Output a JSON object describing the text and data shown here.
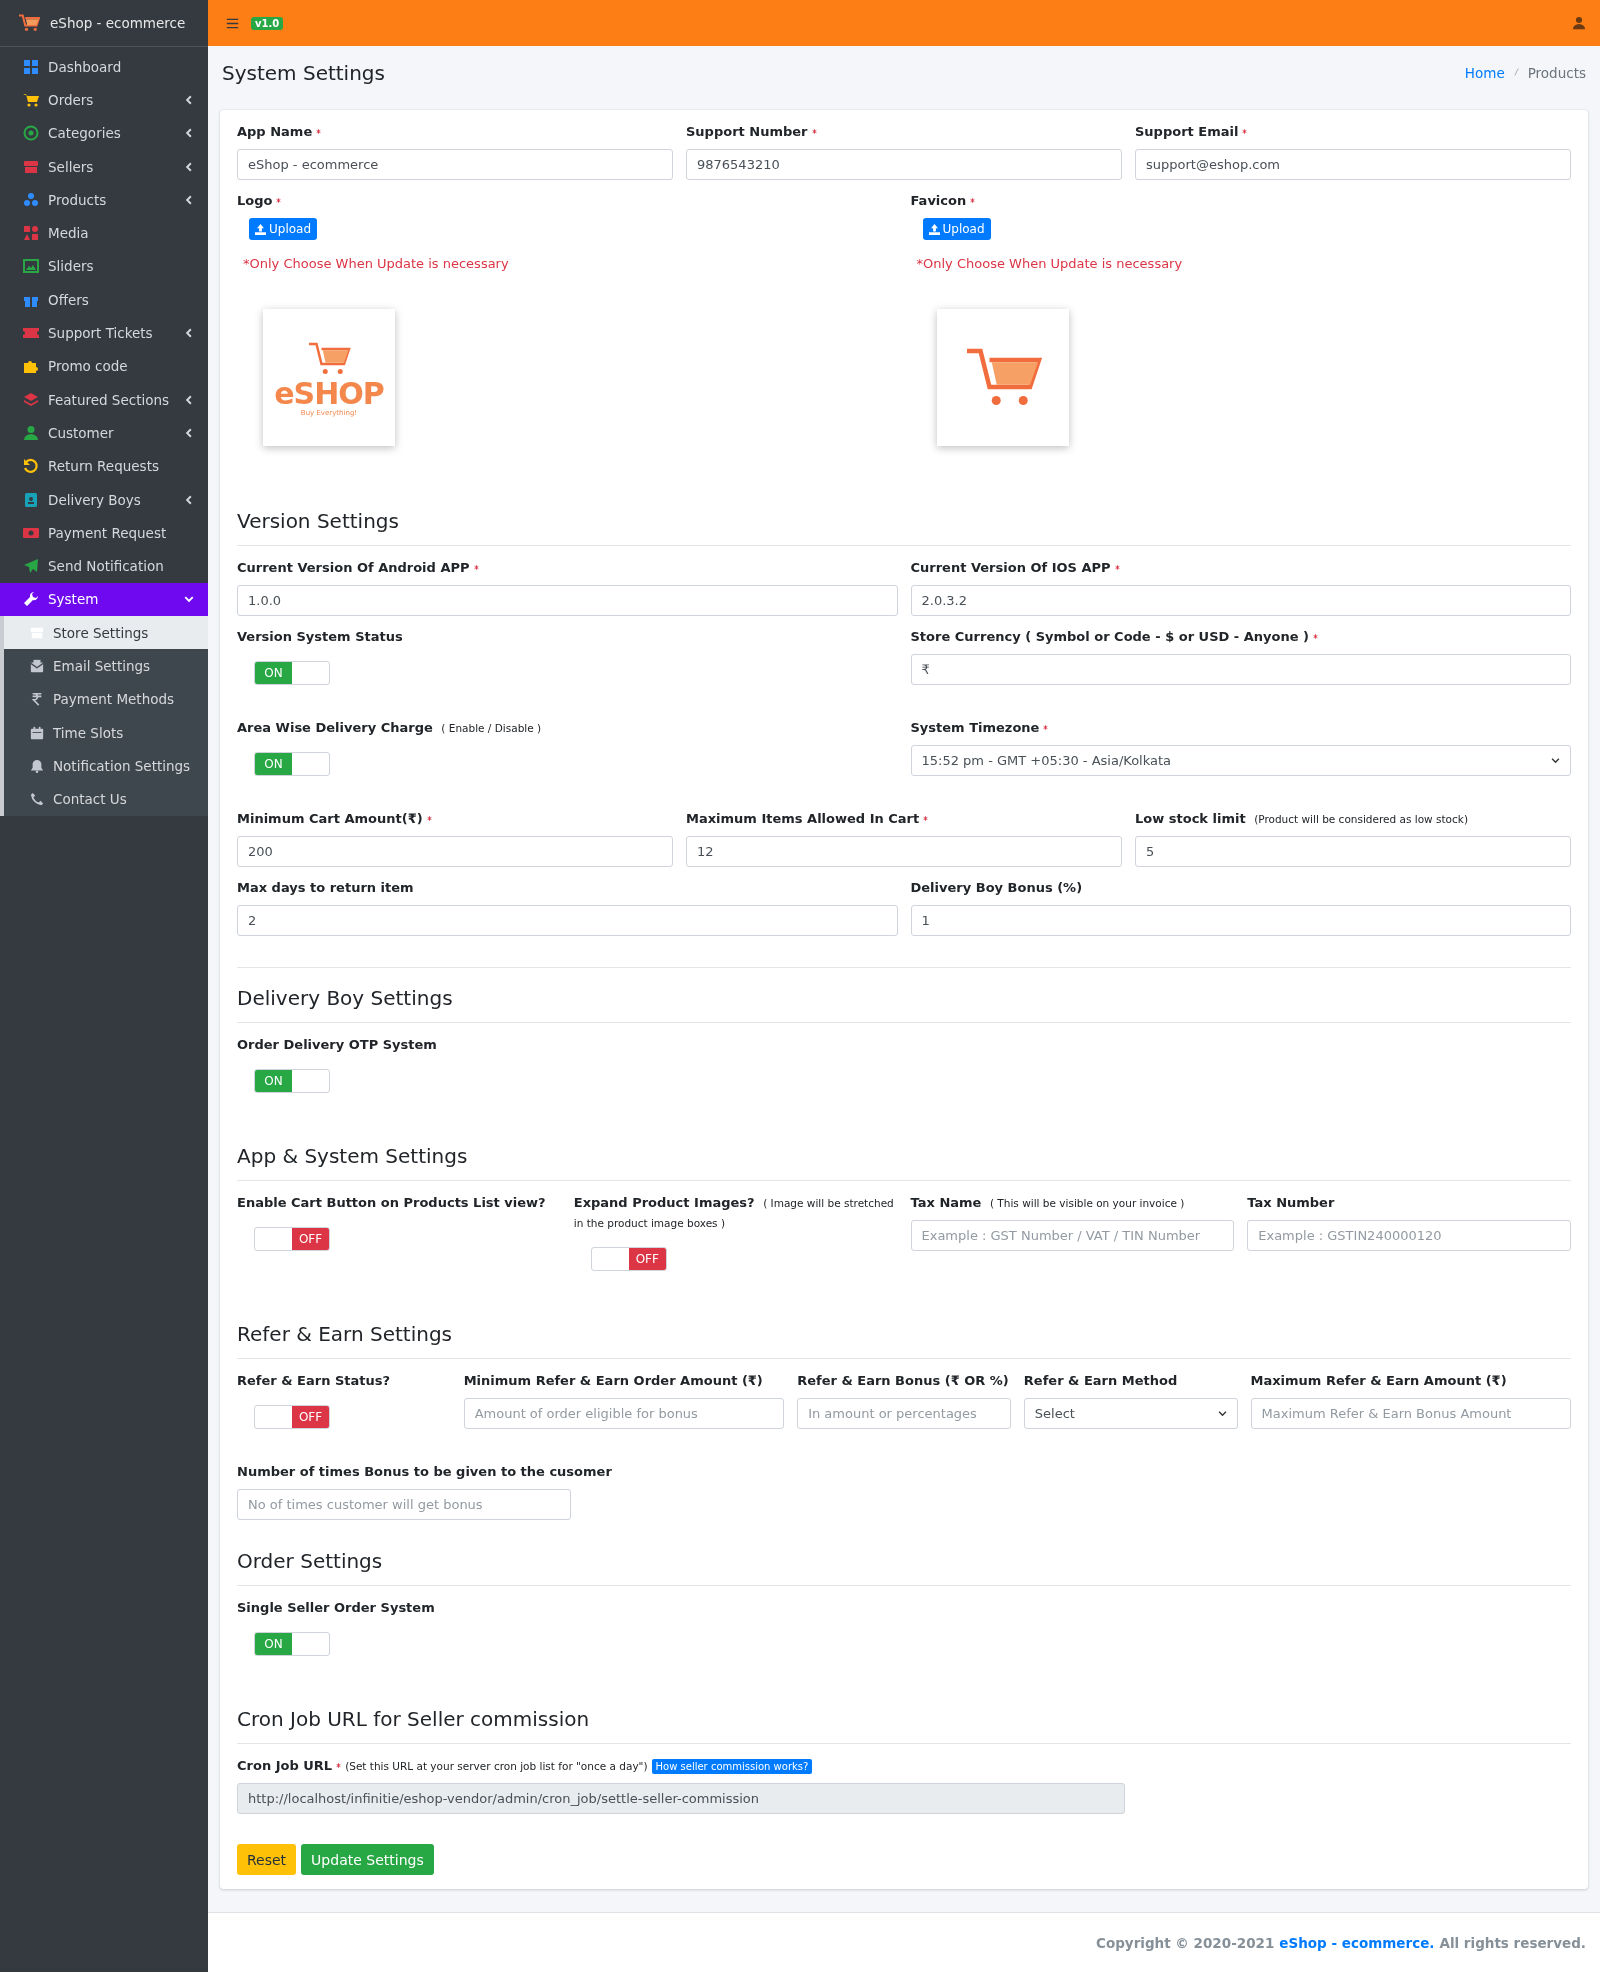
{
  "app": {
    "title": "eShop - ecommerce"
  },
  "sidebar": {
    "items": [
      {
        "label": "Dashboard",
        "expandable": false,
        "selected": false
      },
      {
        "label": "Orders",
        "expandable": true,
        "selected": false
      },
      {
        "label": "Categories",
        "expandable": true,
        "selected": false
      },
      {
        "label": "Sellers",
        "expandable": true,
        "selected": false
      },
      {
        "label": "Products",
        "expandable": true,
        "selected": false
      },
      {
        "label": "Media",
        "expandable": false,
        "selected": false
      },
      {
        "label": "Sliders",
        "expandable": false,
        "selected": false
      },
      {
        "label": "Offers",
        "expandable": false,
        "selected": false
      },
      {
        "label": "Support Tickets",
        "expandable": true,
        "selected": false
      },
      {
        "label": "Promo code",
        "expandable": false,
        "selected": false
      },
      {
        "label": "Featured Sections",
        "expandable": true,
        "selected": false
      },
      {
        "label": "Customer",
        "expandable": true,
        "selected": false
      },
      {
        "label": "Return Requests",
        "expandable": false,
        "selected": false
      },
      {
        "label": "Delivery Boys",
        "expandable": true,
        "selected": false
      },
      {
        "label": "Payment Request",
        "expandable": false,
        "selected": false
      },
      {
        "label": "Send Notification",
        "expandable": false,
        "selected": false
      },
      {
        "label": "System",
        "expandable": true,
        "expanded": true,
        "selected": true,
        "children": [
          {
            "label": "Store Settings",
            "selected": true
          },
          {
            "label": "Email Settings",
            "selected": false
          },
          {
            "label": "Payment Methods",
            "selected": false
          },
          {
            "label": "Time Slots",
            "selected": false
          },
          {
            "label": "Notification Settings",
            "selected": false
          },
          {
            "label": "Contact Us",
            "selected": false
          }
        ]
      }
    ]
  },
  "topbar": {
    "version_badge": "v1.0"
  },
  "page": {
    "title": "System Settings",
    "breadcrumbs": [
      {
        "label": "Home",
        "link": true
      },
      {
        "label": "Products",
        "link": false
      }
    ]
  },
  "sections": [
    {
      "rows": [
        [
          {
            "kind": "text",
            "label": "App Name",
            "required": true,
            "value": "eShop - ecommerce"
          },
          {
            "kind": "text",
            "label": "Support Number",
            "required": true,
            "value": "9876543210"
          },
          {
            "kind": "text",
            "label": "Support Email",
            "required": true,
            "value": "support@eshop.com"
          }
        ],
        [
          {
            "kind": "upload",
            "label": "Logo",
            "required": true,
            "button": "Upload",
            "note": "*Only Choose When Update is necessary",
            "preview": {
              "kind": "logo",
              "title": "eSHOP",
              "tagline": "Buy Everything!"
            }
          },
          {
            "kind": "upload",
            "label": "Favicon",
            "required": true,
            "button": "Upload",
            "note": "*Only Choose When Update is necessary",
            "preview": {
              "kind": "favicon"
            }
          }
        ]
      ]
    },
    {
      "heading": "Version Settings",
      "rows": [
        [
          {
            "kind": "text",
            "label": "Current Version Of Android APP",
            "required": true,
            "value": "1.0.0"
          },
          {
            "kind": "text",
            "label": "Current Version Of IOS APP",
            "required": true,
            "value": "2.0.3.2"
          }
        ],
        [
          {
            "kind": "toggle",
            "label": "Version System Status",
            "required": false,
            "on": true,
            "state_text": "ON"
          },
          {
            "kind": "text",
            "label": "Store Currency ( Symbol or Code - $ or USD - Anyone )",
            "required": true,
            "value": "₹"
          }
        ],
        [
          {
            "kind": "toggle",
            "label": "Area Wise Delivery Charge",
            "hint": "( Enable / Disable )",
            "required": false,
            "on": true,
            "state_text": "ON"
          },
          {
            "kind": "select",
            "label": "System Timezone",
            "required": true,
            "value": "15:52 pm - GMT +05:30 - Asia/Kolkata"
          }
        ],
        [
          {
            "kind": "text",
            "label": "Minimum Cart Amount(₹)",
            "required": true,
            "value": "200"
          },
          {
            "kind": "text",
            "label": "Maximum Items Allowed In Cart",
            "required": true,
            "value": "12"
          },
          {
            "kind": "text",
            "label": "Low stock limit",
            "hint": "(Product will be considered as low stock)",
            "required": false,
            "value": "5"
          }
        ],
        [
          {
            "kind": "text",
            "label": "Max days to return item",
            "required": false,
            "value": "2"
          },
          {
            "kind": "text",
            "label": "Delivery Boy Bonus (%)",
            "required": false,
            "value": "1"
          }
        ]
      ]
    },
    {
      "heading": "Delivery Boy Settings",
      "rows": [
        [
          {
            "kind": "toggle",
            "label": "Order Delivery OTP System",
            "required": false,
            "on": true,
            "state_text": "ON"
          }
        ]
      ]
    },
    {
      "heading": "App & System Settings",
      "rows": [
        [
          {
            "kind": "toggle",
            "label": "Enable Cart Button on Products List view?",
            "required": false,
            "on": false,
            "state_text": "OFF"
          },
          {
            "kind": "toggle",
            "label": "Expand Product Images?",
            "hint": "( Image will be stretched in the product image boxes )",
            "required": false,
            "on": false,
            "state_text": "OFF"
          },
          {
            "kind": "text",
            "label": "Tax Name",
            "hint": "( This will be visible on your invoice )",
            "required": false,
            "placeholder": "Example : GST Number / VAT / TIN Number"
          },
          {
            "kind": "text",
            "label": "Tax Number",
            "required": false,
            "placeholder": "Example : GSTIN240000120"
          }
        ]
      ]
    },
    {
      "heading": "Refer & Earn Settings",
      "rows": [
        [
          {
            "kind": "toggle",
            "label": "Refer & Earn Status?",
            "required": false,
            "on": false,
            "state_text": "OFF"
          },
          {
            "kind": "text",
            "label": "Minimum Refer & Earn Order Amount (₹)",
            "required": false,
            "placeholder": "Amount of order eligible for bonus"
          },
          {
            "kind": "text",
            "label": "Refer & Earn Bonus (₹ OR %)",
            "required": false,
            "placeholder": "In amount or percentages"
          },
          {
            "kind": "select",
            "label": "Refer & Earn Method",
            "required": false,
            "value": "Select"
          },
          {
            "kind": "text",
            "label": "Maximum Refer & Earn Amount (₹)",
            "required": false,
            "placeholder": "Maximum Refer & Earn Bonus Amount"
          }
        ],
        [
          {
            "kind": "text",
            "label": "Number of times Bonus to be given to the cusomer",
            "required": false,
            "placeholder": "No of times customer will get bonus"
          }
        ]
      ]
    },
    {
      "heading": "Order Settings",
      "rows": [
        [
          {
            "kind": "toggle",
            "label": "Single Seller Order System",
            "required": false,
            "on": true,
            "state_text": "ON"
          }
        ]
      ]
    },
    {
      "heading": "Cron Job URL for Seller commission",
      "rows": [
        [
          {
            "kind": "readonly",
            "label": "Cron Job URL",
            "required": true,
            "hint": "(Set this URL at your server cron job list for \"once a day\")",
            "help_badge": "How seller commission works?",
            "value": "http://localhost/infinitie/eshop-vendor/admin/cron_job/settle-seller-commission"
          }
        ]
      ]
    }
  ],
  "actions": [
    {
      "label": "Reset",
      "kind": "warning"
    },
    {
      "label": "Update Settings",
      "kind": "success"
    }
  ],
  "footer": {
    "prefix": "Copyright © 2020-2021",
    "link": "eShop - ecommerce.",
    "suffix": "All rights reserved."
  }
}
